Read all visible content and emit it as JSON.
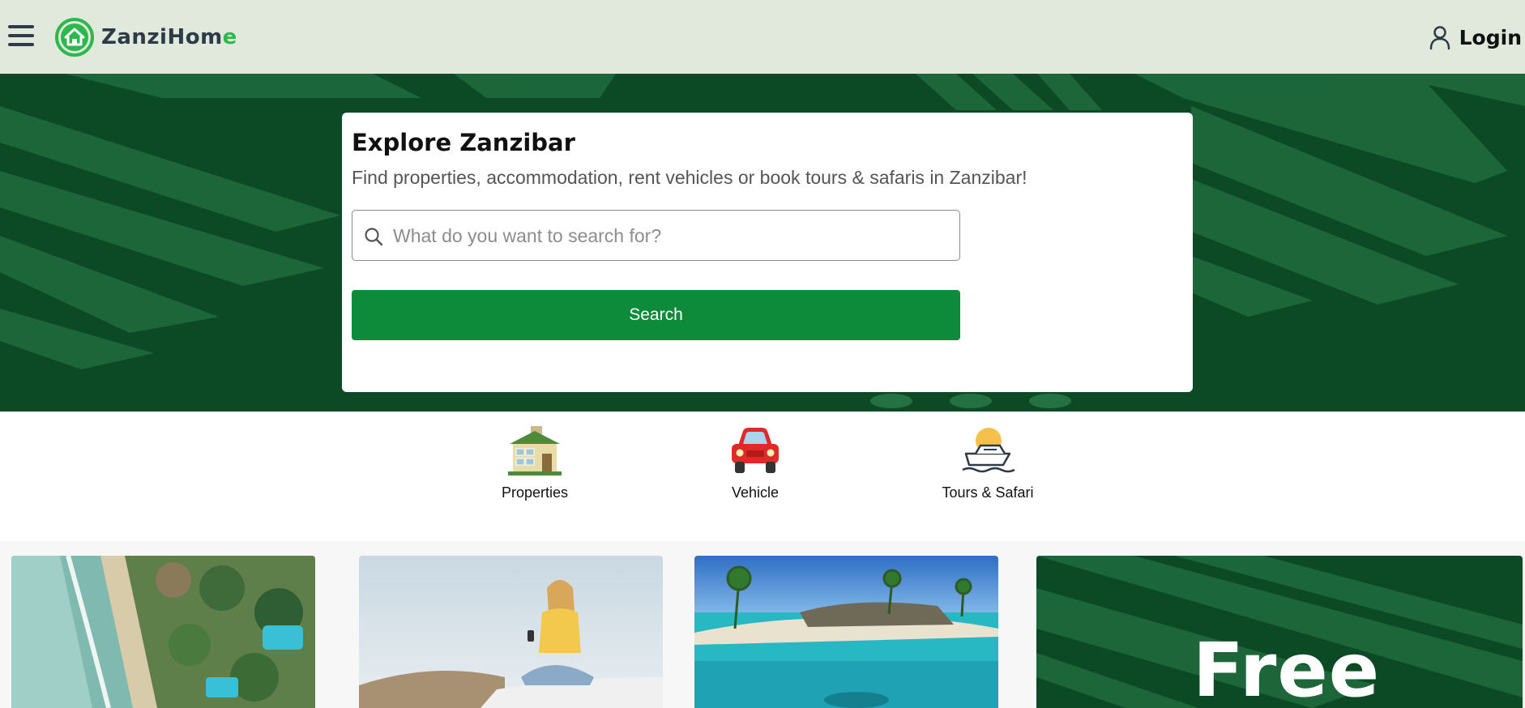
{
  "header": {
    "menu_icon": "hamburger-menu-icon",
    "logo_text_main": "ZanziHom",
    "logo_text_accent": "e",
    "logo_icon": "house-icon",
    "login_label": "Login",
    "login_icon": "user-icon"
  },
  "hero": {
    "title": "Explore Zanzibar",
    "subtitle": "Find properties, accommodation, rent vehicles or book tours & safaris in Zanzibar!",
    "search_placeholder": "What do you want to search for?",
    "search_value": "",
    "search_button_label": "Search"
  },
  "categories": [
    {
      "label": "Properties",
      "icon": "house-icon"
    },
    {
      "label": "Vehicle",
      "icon": "car-icon"
    },
    {
      "label": "Tours & Safari",
      "icon": "boat-icon"
    }
  ],
  "promo_cards": [
    {
      "image": "beach-resort-aerial"
    },
    {
      "image": "woman-on-car-phone"
    },
    {
      "image": "tropical-island-lagoon"
    }
  ],
  "free_card": {
    "text": "Free"
  },
  "colors": {
    "header_bg": "#e1e8dc",
    "hero_bg": "#0b4a24",
    "button_green": "#0e8a3b",
    "logo_accent": "#2db84d",
    "text_dark": "#2e3a47"
  }
}
